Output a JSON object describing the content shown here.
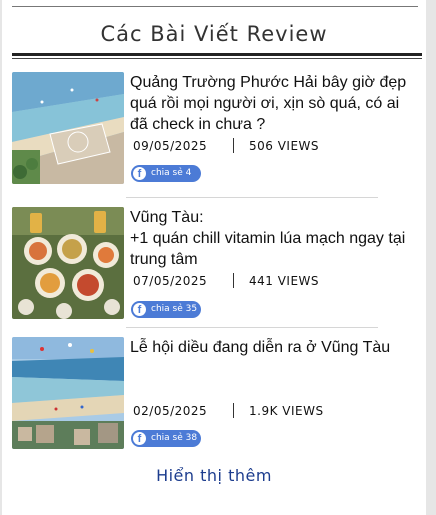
{
  "section_title": "Các Bài Viết Review",
  "articles": [
    {
      "title": "Quảng Trường Phước Hải bây giờ đẹp quá rồi mọi người ơi, xịn sò quá, có ai đã check in chưa ?",
      "date": "09/05/2025",
      "views": "506 VIEWS",
      "share_label": "chia sẻ 4",
      "image": "beach-square-aerial"
    },
    {
      "title": "Vũng Tàu:\n+1 quán chill vitamin lúa mạch ngay tại trung tâm",
      "date": "07/05/2025",
      "views": "441 VIEWS",
      "share_label": "chia sẻ 35",
      "image": "food-table-beer"
    },
    {
      "title": "Lễ hội diều đang diễn ra ở Vũng Tàu",
      "date": "02/05/2025",
      "views": "1.9K VIEWS",
      "share_label": "chia sẻ 38",
      "image": "kite-festival-beach"
    }
  ],
  "show_more_label": "Hiển thị thêm",
  "colors": {
    "share_button": "#4c7bd6",
    "show_more": "#1d3d8e",
    "heading": "#333333"
  },
  "icons": [
    "facebook-icon"
  ]
}
